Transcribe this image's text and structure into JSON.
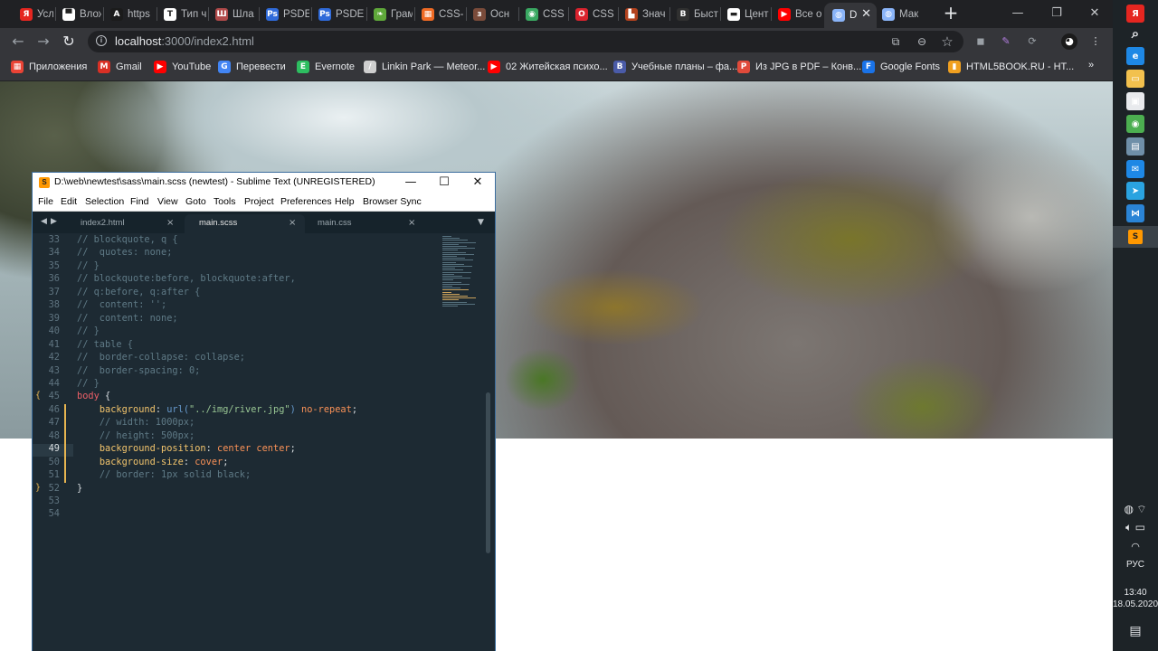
{
  "browser": {
    "tabs": [
      {
        "title": "Усло",
        "icon": "yandex-icon",
        "color": "#e52620",
        "glyph": "Я"
      },
      {
        "title": "Влож",
        "icon": "message-icon",
        "color": "#ffffff",
        "glyph": "▀"
      },
      {
        "title": "https",
        "icon": "angular-icon",
        "color": "#1b1b1b",
        "glyph": "A"
      },
      {
        "title": "Тип ч",
        "icon": "typing-icon",
        "color": "#ffffff",
        "glyph": "T"
      },
      {
        "title": "Шла",
        "icon": "slides-icon",
        "color": "#b04a4a",
        "glyph": "Ш"
      },
      {
        "title": "PSDE",
        "icon": "photoshop-icon",
        "color": "#2f6ad9",
        "glyph": "Ps"
      },
      {
        "title": "PSDE",
        "icon": "photoshop-icon",
        "color": "#2f6ad9",
        "glyph": "Ps"
      },
      {
        "title": "Грам",
        "icon": "leaf-icon",
        "color": "#5fa83a",
        "glyph": "❧"
      },
      {
        "title": "CSS-",
        "icon": "grid-icon",
        "color": "#ef6a24",
        "glyph": "▦"
      },
      {
        "title": "Осн",
        "icon": "book-icon",
        "color": "#7a4b3a",
        "glyph": "з"
      },
      {
        "title": "CSS",
        "icon": "globe-icon",
        "color": "#3aa862",
        "glyph": "◉"
      },
      {
        "title": "CSS",
        "icon": "opera-icon",
        "color": "#d9232e",
        "glyph": "O"
      },
      {
        "title": "Знач",
        "icon": "bricks-icon",
        "color": "#b3421e",
        "glyph": "▙"
      },
      {
        "title": "Быст",
        "icon": "bolt-icon",
        "color": "#303030",
        "glyph": "B"
      },
      {
        "title": "Цент",
        "icon": "chat-icon",
        "color": "#ffffff",
        "glyph": "▬"
      },
      {
        "title": "Все о",
        "icon": "youtube-icon",
        "color": "#ff0000",
        "glyph": "▶"
      },
      {
        "title": "D",
        "icon": "globe-icon",
        "color": "#8ab4f8",
        "glyph": "◍"
      },
      {
        "title": "Мак",
        "icon": "globe-icon",
        "color": "#8ab4f8",
        "glyph": "◍"
      }
    ],
    "new_tab": "+",
    "window_controls": {
      "minimize": "—",
      "restore": "❐",
      "close": "✕"
    },
    "nav": {
      "back": "←",
      "forward": "→",
      "reload": "↻"
    },
    "url": {
      "host": "localhost",
      "path": ":3000/index2.html"
    },
    "omnibox_icons": {
      "translate": "⧉",
      "zoom": "⊖",
      "star": "☆"
    },
    "extensions": [
      {
        "name": "extension-icon",
        "glyph": "◼",
        "color": "#9aa0a6"
      },
      {
        "name": "pen-extension-icon",
        "glyph": "✎",
        "color": "#b37ee0"
      },
      {
        "name": "sync-extension-icon",
        "glyph": "⟳",
        "color": "#9aa0a6"
      }
    ],
    "bookmarks": [
      {
        "label": "Приложения",
        "icon": "apps-grid-icon",
        "color": "#ea4335",
        "glyph": "▦"
      },
      {
        "label": "Gmail",
        "icon": "gmail-icon",
        "color": "#d93025",
        "glyph": "M"
      },
      {
        "label": "YouTube",
        "icon": "youtube-icon",
        "color": "#ff0000",
        "glyph": "▶"
      },
      {
        "label": "Перевести",
        "icon": "translate-icon",
        "color": "#4285f4",
        "glyph": "G"
      },
      {
        "label": "Evernote",
        "icon": "evernote-icon",
        "color": "#2dbe60",
        "glyph": "E"
      },
      {
        "label": "Linkin Park — Meteor...",
        "icon": "feather-icon",
        "color": "#cfcfcf",
        "glyph": "/"
      },
      {
        "label": "02 Житейская психо...",
        "icon": "youtube-icon",
        "color": "#ff0000",
        "glyph": "▶"
      },
      {
        "label": "Учебные планы – фа...",
        "icon": "crest-icon",
        "color": "#4a5ba8",
        "glyph": "B"
      },
      {
        "label": "Из JPG в PDF – Конв...",
        "icon": "jpg-pdf-icon",
        "color": "#e04a3a",
        "glyph": "P"
      },
      {
        "label": "Google Fonts",
        "icon": "google-fonts-icon",
        "color": "#1a73e8",
        "glyph": "F"
      },
      {
        "label": "HTML5BOOK.RU - HT...",
        "icon": "html5book-icon",
        "color": "#f0a020",
        "glyph": "▮"
      }
    ],
    "bookmarks_overflow": "»"
  },
  "sublime": {
    "title": "D:\\web\\newtest\\sass\\main.scss (newtest) - Sublime Text (UNREGISTERED)",
    "logo": "S",
    "menu": [
      "File",
      "Edit",
      "Selection",
      "Find",
      "View",
      "Goto",
      "Tools",
      "Project",
      "Preferences",
      "Help",
      "Browser Sync"
    ],
    "tabs": [
      {
        "name": "index2.html",
        "close": "×"
      },
      {
        "name": "main.scss",
        "close": "×"
      },
      {
        "name": "main.css",
        "close": "×"
      }
    ],
    "tab_nav": {
      "left": "◀",
      "right": "▶",
      "dropdown": "▼"
    },
    "gutter_marks": {
      "open": "{",
      "close": "}"
    },
    "lines": [
      {
        "n": "33",
        "t": [
          [
            "c-com",
            "// blockquote, q {"
          ]
        ]
      },
      {
        "n": "34",
        "t": [
          [
            "c-com",
            "//  quotes: none;"
          ]
        ]
      },
      {
        "n": "35",
        "t": [
          [
            "c-com",
            "// }"
          ]
        ]
      },
      {
        "n": "36",
        "t": [
          [
            "c-com",
            "// blockquote:before, blockquote:after,"
          ]
        ]
      },
      {
        "n": "37",
        "t": [
          [
            "c-com",
            "// q:before, q:after {"
          ]
        ]
      },
      {
        "n": "38",
        "t": [
          [
            "c-com",
            "//  content: '';"
          ]
        ]
      },
      {
        "n": "39",
        "t": [
          [
            "c-com",
            "//  content: none;"
          ]
        ]
      },
      {
        "n": "40",
        "t": [
          [
            "c-com",
            "// }"
          ]
        ]
      },
      {
        "n": "41",
        "t": [
          [
            "c-com",
            "// table {"
          ]
        ]
      },
      {
        "n": "42",
        "t": [
          [
            "c-com",
            "//  border-collapse: collapse;"
          ]
        ]
      },
      {
        "n": "43",
        "t": [
          [
            "c-com",
            "//  border-spacing: 0;"
          ]
        ]
      },
      {
        "n": "44",
        "t": [
          [
            "c-com",
            "// }"
          ]
        ]
      },
      {
        "n": "45",
        "t": [
          [
            "c-sel",
            "body"
          ],
          [
            "c-pun",
            " {"
          ]
        ]
      },
      {
        "n": "46",
        "t": [
          [
            "c-pun",
            "    "
          ],
          [
            "c-prop",
            "background"
          ],
          [
            "c-pun",
            ": "
          ],
          [
            "c-fn",
            "url("
          ],
          [
            "c-str",
            "\"../img/river.jpg\""
          ],
          [
            "c-fn",
            ")"
          ],
          [
            "c-pun",
            " "
          ],
          [
            "c-val",
            "no-repeat"
          ],
          [
            "c-pun",
            ";"
          ]
        ]
      },
      {
        "n": "47",
        "t": [
          [
            "c-pun",
            "    "
          ],
          [
            "c-com",
            "// width: 1000px;"
          ]
        ]
      },
      {
        "n": "48",
        "t": [
          [
            "c-pun",
            "    "
          ],
          [
            "c-com",
            "// height: 500px;"
          ]
        ]
      },
      {
        "n": "49",
        "t": [
          [
            "c-pun",
            "    "
          ],
          [
            "c-prop",
            "background-position"
          ],
          [
            "c-pun",
            ": "
          ],
          [
            "c-val",
            "center center"
          ],
          [
            "c-pun",
            ";"
          ]
        ]
      },
      {
        "n": "50",
        "t": [
          [
            "c-pun",
            "    "
          ],
          [
            "c-prop",
            "background-size"
          ],
          [
            "c-pun",
            ": "
          ],
          [
            "c-val",
            "cover"
          ],
          [
            "c-pun",
            ";"
          ]
        ]
      },
      {
        "n": "51",
        "t": [
          [
            "c-pun",
            "    "
          ],
          [
            "c-com",
            "// border: 1px solid black;"
          ]
        ]
      },
      {
        "n": "52",
        "t": [
          [
            "c-pun",
            "}"
          ]
        ]
      },
      {
        "n": "53",
        "t": []
      },
      {
        "n": "54",
        "t": []
      }
    ],
    "current_line": "49"
  },
  "taskbar": {
    "apps": [
      {
        "name": "yandex-browser-icon",
        "glyph": "Я",
        "color": "#e52620"
      },
      {
        "name": "search-icon",
        "glyph": "⌕",
        "color": "#1d2327"
      },
      {
        "name": "edge-icon",
        "glyph": "e",
        "color": "#1e88e5"
      },
      {
        "name": "file-explorer-icon",
        "glyph": "▭",
        "color": "#f2c14e"
      },
      {
        "name": "store-icon",
        "glyph": "▣",
        "color": "#e8eaed"
      },
      {
        "name": "chrome-icon",
        "glyph": "◉",
        "color": "#4caf50"
      },
      {
        "name": "photos-icon",
        "glyph": "▤",
        "color": "#6f8fa8"
      },
      {
        "name": "mail-icon",
        "glyph": "✉",
        "color": "#1e88e5"
      },
      {
        "name": "telegram-icon",
        "glyph": "➤",
        "color": "#2aa3e0"
      },
      {
        "name": "vscode-icon",
        "glyph": "⋈",
        "color": "#2a84d6"
      },
      {
        "name": "sublime-text-icon",
        "glyph": "S",
        "color": "#ff9800"
      }
    ],
    "lang": "РУС",
    "time": "13:40",
    "date": "18.05.2020",
    "notifications": "▤"
  }
}
